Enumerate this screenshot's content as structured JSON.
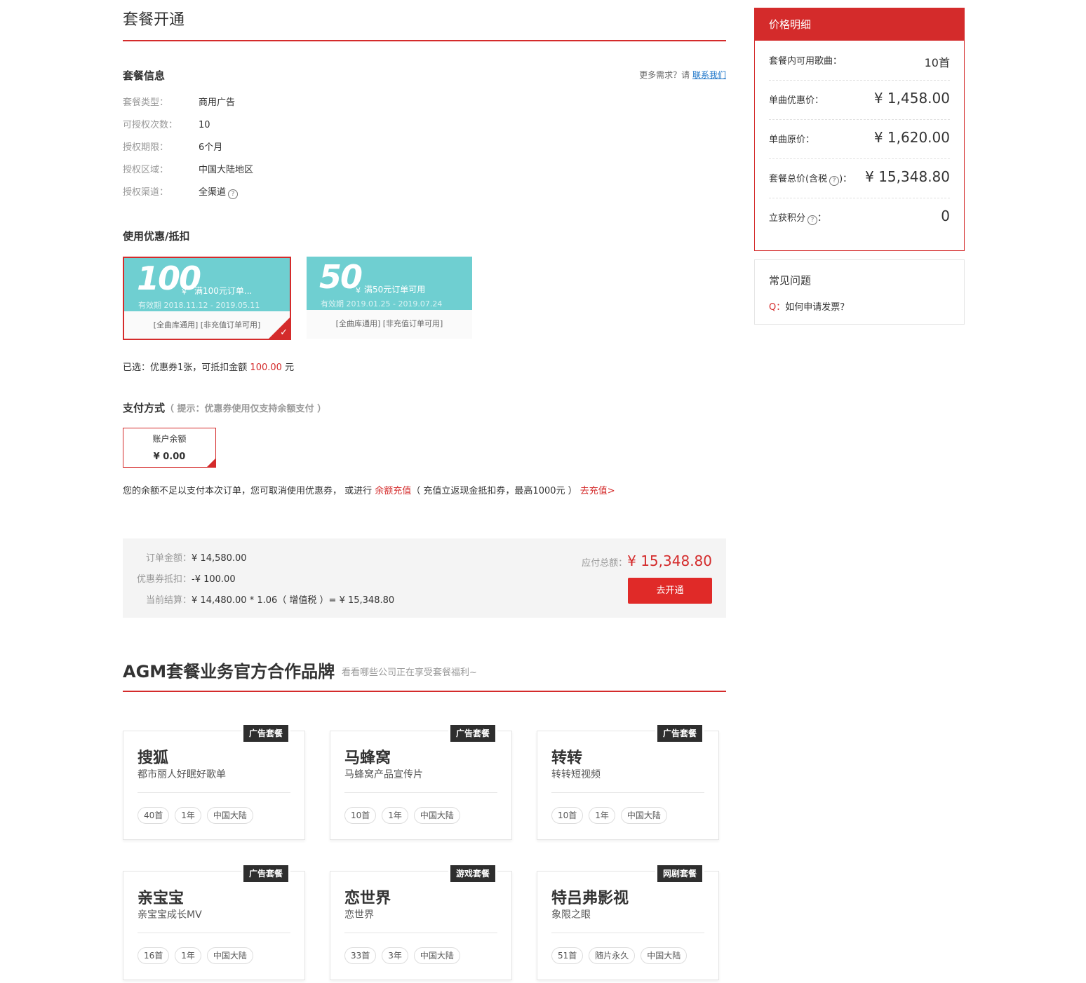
{
  "page": {
    "title": "套餐开通"
  },
  "package_info": {
    "section_title": "套餐信息",
    "more_prompt": "更多需求？请",
    "contact_link": "联系我们",
    "rows": [
      {
        "label": "套餐类型：",
        "value": "商用广告"
      },
      {
        "label": "可授权次数：",
        "value": "10"
      },
      {
        "label": "授权期限：",
        "value": "6个月"
      },
      {
        "label": "授权区域：",
        "value": "中国大陆地区"
      },
      {
        "label": "授权渠道：",
        "value": "全渠道"
      }
    ],
    "help_icon": "question-circle-icon"
  },
  "coupons": {
    "section_title": "使用优惠/抵扣",
    "items": [
      {
        "amount": "100",
        "currency": "¥",
        "condition": "满100元订单...",
        "validity": "有效期 2018.11.12 - 2019.05.11",
        "scope": "[全曲库通用]   [非充值订单可用]",
        "selected": true
      },
      {
        "amount": "50",
        "currency": "¥",
        "condition": "满50元订单可用",
        "validity": "有效期 2019.01.25 - 2019.07.24",
        "scope": "[全曲库通用]   [非充值订单可用]",
        "selected": false
      }
    ],
    "selected_note_prefix": "已选：优惠券1张，可抵扣金额",
    "selected_amount": "100.00",
    "selected_unit": "元"
  },
  "payment": {
    "section_title": "支付方式",
    "hint": "（ 提示：优惠券使用仅支持余额支付 ）",
    "method_label": "账户余额",
    "method_balance": "¥ 0.00",
    "note_part1": "您的余额不足以支付本次订单，您可取消使用优惠券， 或进行",
    "note_link1": "余额充值",
    "note_part2": "（ 充值立返现金抵扣券，最高1000元 ）",
    "note_link2": "去充值>"
  },
  "summary": {
    "order_label": "订单金额：",
    "order_value": "¥ 14,580.00",
    "coupon_label": "优惠券抵扣：",
    "coupon_value": "-¥ 100.00",
    "settle_label": "当前结算：",
    "settle_value": "¥ 14,480.00 * 1.06（ 增值税 ）= ¥ 15,348.80",
    "total_label": "应付总额：",
    "total_value": "¥ 15,348.80",
    "submit_label": "去开通"
  },
  "brands": {
    "title": "AGM套餐业务官方合作品牌",
    "subtitle": "看看哪些公司正在享受套餐福利~",
    "cards": [
      {
        "tag": "广告套餐",
        "name": "搜狐",
        "desc": "都市丽人好眠好歌单",
        "chips": [
          "40首",
          "1年",
          "中国大陆"
        ]
      },
      {
        "tag": "广告套餐",
        "name": "马蜂窝",
        "desc": "马蜂窝产品宣传片",
        "chips": [
          "10首",
          "1年",
          "中国大陆"
        ]
      },
      {
        "tag": "广告套餐",
        "name": "转转",
        "desc": "转转短视频",
        "chips": [
          "10首",
          "1年",
          "中国大陆"
        ]
      },
      {
        "tag": "广告套餐",
        "name": "亲宝宝",
        "desc": "亲宝宝成长MV",
        "chips": [
          "16首",
          "1年",
          "中国大陆"
        ]
      },
      {
        "tag": "游戏套餐",
        "name": "恋世界",
        "desc": "恋世界",
        "chips": [
          "33首",
          "3年",
          "中国大陆"
        ]
      },
      {
        "tag": "网剧套餐",
        "name": "特吕弗影视",
        "desc": "象限之眼",
        "chips": [
          "51首",
          "随片永久",
          "中国大陆"
        ]
      }
    ]
  },
  "price_detail": {
    "title": "价格明细",
    "rows": [
      {
        "label": "套餐内可用歌曲：",
        "value": "10首",
        "red": true
      },
      {
        "label": "单曲优惠价：",
        "value": "¥ 1,458.00",
        "red": true
      },
      {
        "label": "单曲原价：",
        "value": "¥ 1,620.00",
        "red": false
      },
      {
        "label": "套餐总价(含税",
        "label_suffix": ")：",
        "value": "¥ 15,348.80",
        "red": true
      },
      {
        "label": "立获积分",
        "label_suffix": "：",
        "value": "0",
        "red": false
      }
    ]
  },
  "faq": {
    "title": "常见问题",
    "q_prefix": "Q：",
    "question": "如何申请发票？"
  },
  "colors": {
    "accent": "#d42b2b",
    "coupon": "#6fcfd1",
    "button": "#e02a28"
  }
}
